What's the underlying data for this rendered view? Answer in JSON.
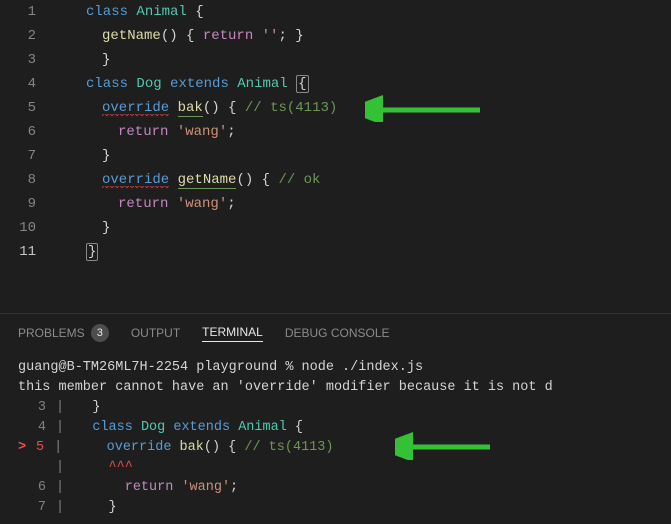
{
  "editor": {
    "lines": [
      {
        "n": 1,
        "indent": 0,
        "kind": "class_open1"
      },
      {
        "n": 2,
        "indent": 1,
        "kind": "getname_inline"
      },
      {
        "n": 3,
        "indent": 1,
        "kind": "brace_close"
      },
      {
        "n": 4,
        "indent": 0,
        "kind": "class_open2"
      },
      {
        "n": 5,
        "indent": 1,
        "kind": "override_bak"
      },
      {
        "n": 6,
        "indent": 2,
        "kind": "return_wang"
      },
      {
        "n": 7,
        "indent": 1,
        "kind": "brace_close"
      },
      {
        "n": 8,
        "indent": 1,
        "kind": "override_getname"
      },
      {
        "n": 9,
        "indent": 2,
        "kind": "return_wang"
      },
      {
        "n": 10,
        "indent": 1,
        "kind": "brace_close"
      },
      {
        "n": 11,
        "indent": 0,
        "kind": "brace_close_hl"
      }
    ],
    "tokens": {
      "class": "class",
      "Animal": "Animal",
      "Dog": "Dog",
      "extends": "extends",
      "getName": "getName",
      "return": "return",
      "empty_str": "''",
      "override": "override",
      "bak": "bak",
      "wang": "'wang'",
      "comment_err": "// ts(4113)",
      "comment_ok": "// ok"
    }
  },
  "tabs": {
    "problems": "PROBLEMS",
    "problems_count": "3",
    "output": "OUTPUT",
    "terminal": "TERMINAL",
    "debug": "DEBUG CONSOLE"
  },
  "terminal": {
    "prompt": "guang@B-TM26ML7H-2254 playground % node ./index.js",
    "error_msg": "this member cannot have an 'override' modifier because it is not d",
    "snippet": [
      {
        "n": "3",
        "err": false,
        "kind": "brace_close",
        "indent": 1
      },
      {
        "n": "4",
        "err": false,
        "kind": "class_open2",
        "indent": 0
      },
      {
        "n": "5",
        "err": true,
        "kind": "override_bak_term",
        "indent": 1
      },
      {
        "n": "",
        "err": false,
        "kind": "caret",
        "indent": 1
      },
      {
        "n": "6",
        "err": false,
        "kind": "return_wang",
        "indent": 2
      },
      {
        "n": "7",
        "err": false,
        "kind": "brace_close",
        "indent": 1
      }
    ]
  }
}
